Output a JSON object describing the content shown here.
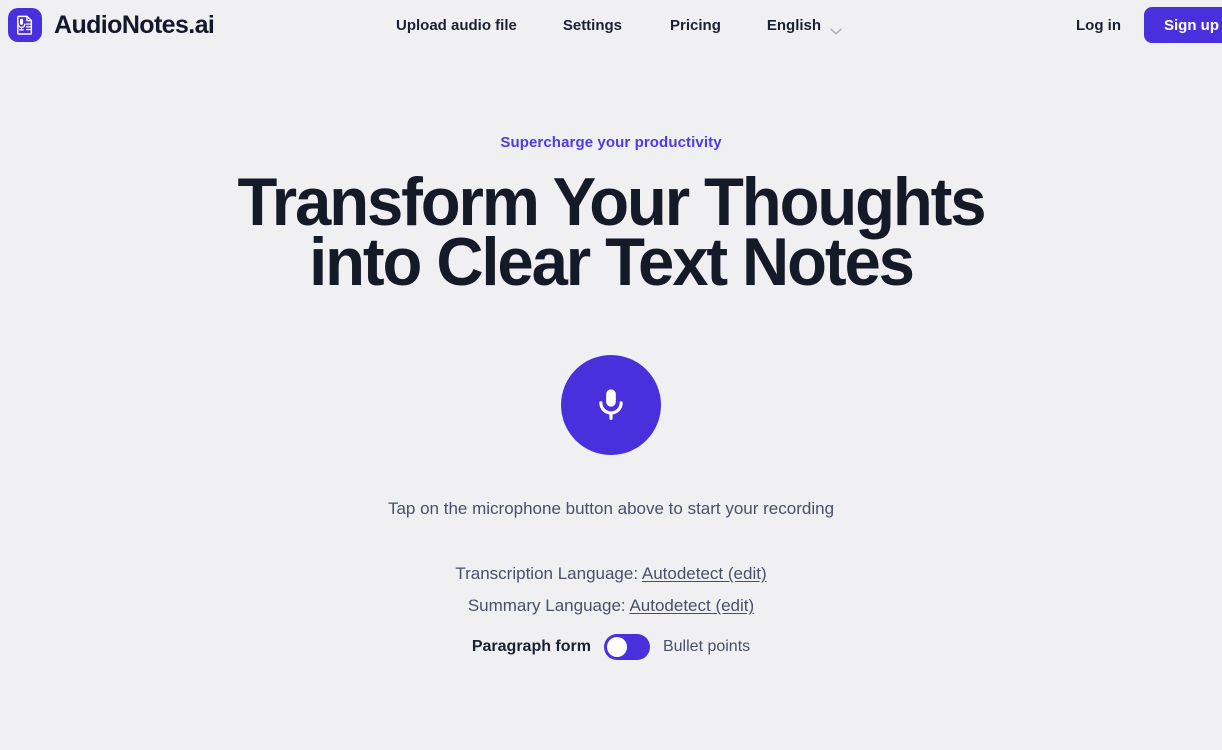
{
  "theme": {
    "background": "#f0f0f3",
    "accent": "#4a30dd",
    "accent_text": "#4f39e8",
    "heading": "#151a28",
    "body_text": "#47506b"
  },
  "header": {
    "logo_icon": "document-microphone-icon",
    "brand": "AudioNotes.ai",
    "nav": [
      {
        "label": "Upload audio file",
        "name": "nav-upload-audio-file"
      },
      {
        "label": "Settings",
        "name": "nav-settings"
      },
      {
        "label": "Pricing",
        "name": "nav-pricing"
      }
    ],
    "language": {
      "label": "English",
      "chevron_icon": "chevron-down-icon"
    },
    "login_label": "Log in",
    "signup_label": "Sign up"
  },
  "hero": {
    "eyebrow": "Supercharge your productivity",
    "headline_line1": "Transform Your Thoughts",
    "headline_line2": "into Clear Text Notes"
  },
  "recorder": {
    "mic_icon": "microphone-icon",
    "hint": "Tap on the microphone button above to start your recording"
  },
  "options": {
    "transcription_label": "Transcription Language:",
    "transcription_value": "Autodetect (edit)",
    "summary_label": "Summary Language:",
    "summary_value": "Autodetect (edit)",
    "toggle_left_label": "Paragraph form",
    "toggle_right_label": "Bullet points",
    "toggle_state": "Paragraph form"
  }
}
